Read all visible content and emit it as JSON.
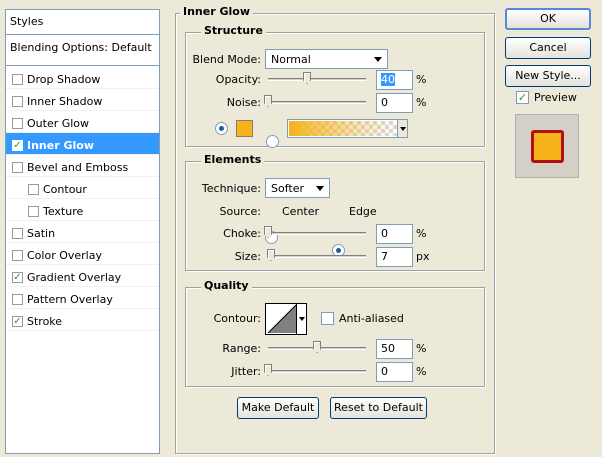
{
  "styles_panel": {
    "header": "Styles",
    "blending_options": "Blending Options: Default",
    "items": [
      {
        "label": "Drop Shadow",
        "checked": false,
        "sub": false,
        "selected": false
      },
      {
        "label": "Inner Shadow",
        "checked": false,
        "sub": false,
        "selected": false
      },
      {
        "label": "Outer Glow",
        "checked": false,
        "sub": false,
        "selected": false
      },
      {
        "label": "Inner Glow",
        "checked": true,
        "sub": false,
        "selected": true
      },
      {
        "label": "Bevel and Emboss",
        "checked": false,
        "sub": false,
        "selected": false
      },
      {
        "label": "Contour",
        "checked": false,
        "sub": true,
        "selected": false
      },
      {
        "label": "Texture",
        "checked": false,
        "sub": true,
        "selected": false
      },
      {
        "label": "Satin",
        "checked": false,
        "sub": false,
        "selected": false
      },
      {
        "label": "Color Overlay",
        "checked": false,
        "sub": false,
        "selected": false
      },
      {
        "label": "Gradient Overlay",
        "checked": true,
        "sub": false,
        "selected": false
      },
      {
        "label": "Pattern Overlay",
        "checked": false,
        "sub": false,
        "selected": false
      },
      {
        "label": "Stroke",
        "checked": true,
        "sub": false,
        "selected": false
      }
    ]
  },
  "panel_title": "Inner Glow",
  "structure": {
    "title": "Structure",
    "blend_mode_label": "Blend Mode:",
    "blend_mode": "Normal",
    "opacity_label": "Opacity:",
    "opacity_value": "40",
    "opacity_fraction": 0.4,
    "noise_label": "Noise:",
    "noise_value": "0",
    "noise_fraction": 0.0,
    "percent": "%",
    "glow_color": "#f7b21c"
  },
  "elements": {
    "title": "Elements",
    "technique_label": "Technique:",
    "technique": "Softer",
    "source_label": "Source:",
    "source_center": "Center",
    "source_edge": "Edge",
    "choke_label": "Choke:",
    "choke_value": "0",
    "choke_fraction": 0.0,
    "size_label": "Size:",
    "size_value": "7",
    "size_fraction": 0.03,
    "percent": "%",
    "px": "px"
  },
  "quality": {
    "title": "Quality",
    "contour_label": "Contour:",
    "anti_aliased_label": "Anti-aliased",
    "range_label": "Range:",
    "range_value": "50",
    "range_fraction": 0.5,
    "jitter_label": "Jitter:",
    "jitter_value": "0",
    "jitter_fraction": 0.0,
    "percent": "%"
  },
  "buttons": {
    "make_default": "Make Default",
    "reset_to_default": "Reset to Default",
    "ok": "OK",
    "cancel": "Cancel",
    "new_style": "New Style...",
    "preview": "Preview"
  },
  "preview_colors": {
    "fill": "#f7b21c",
    "stroke": "#b01010"
  }
}
